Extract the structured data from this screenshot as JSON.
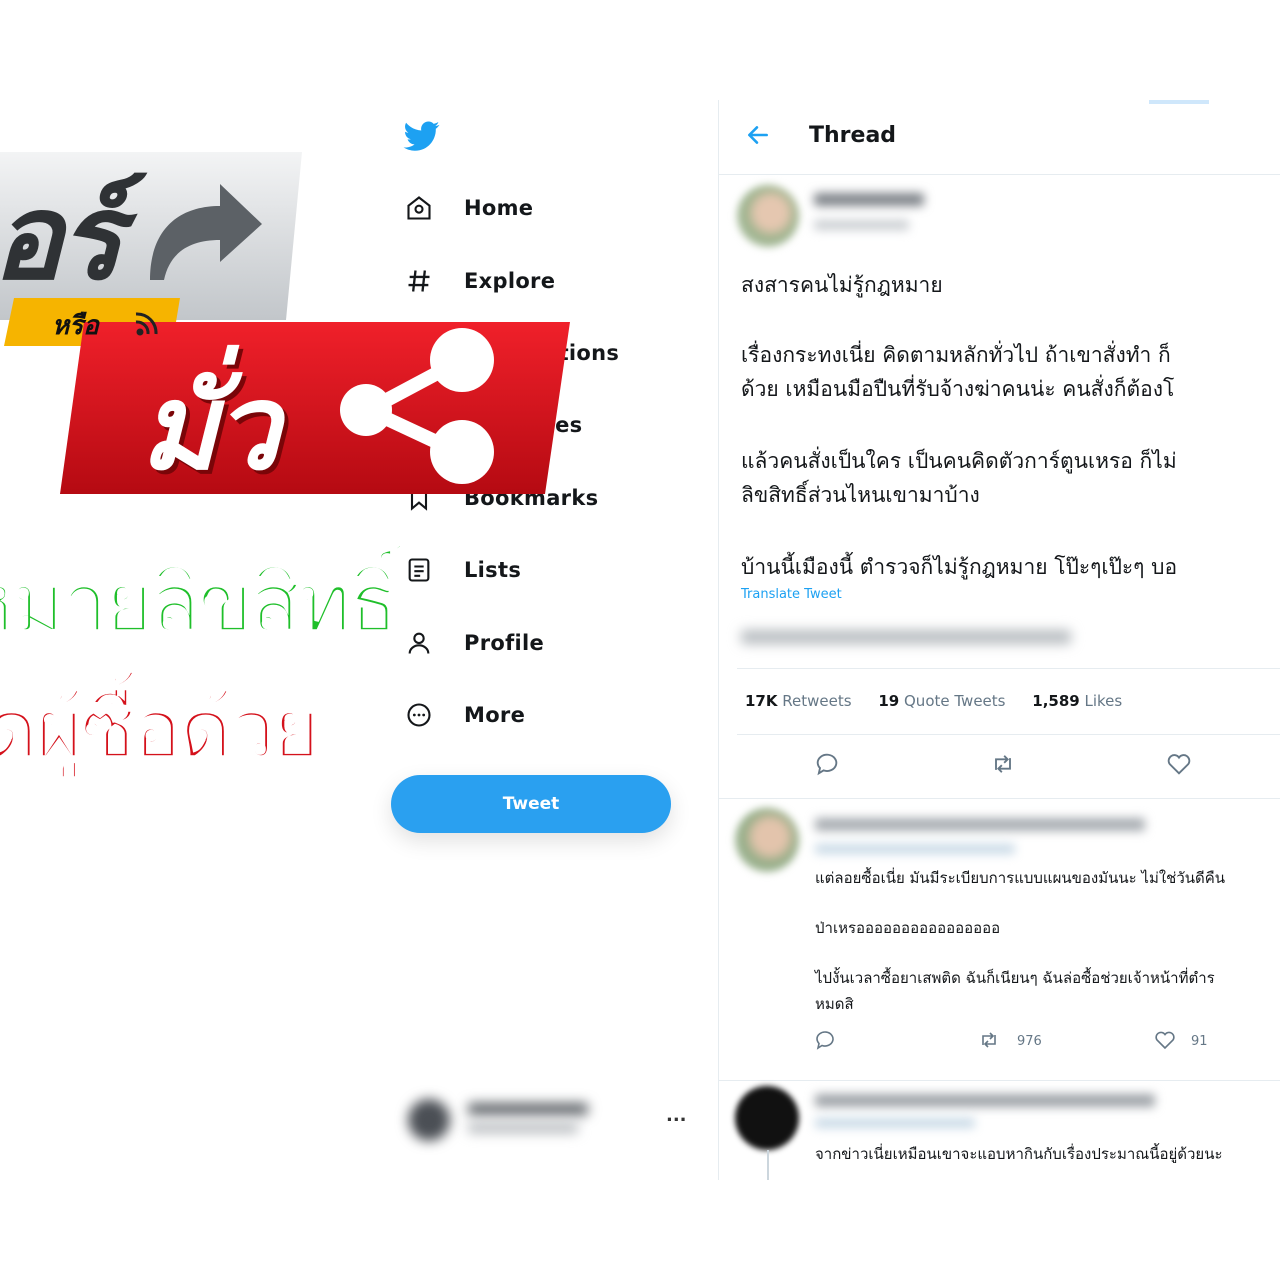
{
  "nav": {
    "items": [
      {
        "id": "home",
        "label": "Home",
        "icon": "home-icon"
      },
      {
        "id": "explore",
        "label": "Explore",
        "icon": "hashtag-icon"
      },
      {
        "id": "notifications",
        "label": "Notifications",
        "icon": "bell-icon"
      },
      {
        "id": "messages",
        "label": "Messages",
        "icon": "mail-icon"
      },
      {
        "id": "bookmarks",
        "label": "Bookmarks",
        "icon": "bookmark-icon"
      },
      {
        "id": "lists",
        "label": "Lists",
        "icon": "list-icon"
      },
      {
        "id": "profile",
        "label": "Profile",
        "icon": "person-icon"
      },
      {
        "id": "more",
        "label": "More",
        "icon": "more-circle-icon"
      }
    ],
    "tweet_button": "Tweet",
    "account_more": "..."
  },
  "thread": {
    "title": "Thread",
    "tweet": {
      "paragraphs": [
        "สงสารคนไม่รู้กฎหมาย",
        "เรื่องกระทงเนี่ย คิดตามหลักทั่วไป ถ้าเขาสั่งทำ ก็",
        "ด้วย เหมือนมือปืนที่รับจ้างฆ่าคนน่ะ คนสั่งก็ต้องโ",
        "แล้วคนสั่งเป็นใคร เป็นคนคิดตัวการ์ตูนเหรอ ก็ไม่",
        "ลิขสิทธิ์ส่วนไหนเขามาบ้าง",
        "บ้านนี้เมืองนี้ ตำรวจก็ไม่รู้กฎหมาย โป๊ะๆเป๊ะๆ บอ"
      ],
      "translate": "Translate Tweet",
      "stats": {
        "retweets_count": "17K",
        "retweets_label": "Retweets",
        "quotes_count": "19",
        "quotes_label": "Quote Tweets",
        "likes_count": "1,589",
        "likes_label": "Likes"
      }
    },
    "reply1": {
      "lines": [
        "แต่ลอยซื้อเนี่ย มันมีระเบียบการแบบแผนของมันนะ ไม่ใช่วันดีคืน",
        "ป่าเหรออออออออออออออออ",
        "ไปงั้นเวลาซื้อยาเสพติด ฉันก็เนียนๆ ฉันล่อซื้อช่วยเจ้าหน้าที่ตำร",
        "หมดสิ"
      ],
      "retweets": "976",
      "likes": "91"
    },
    "reply2": {
      "lines": [
        "จากข่าวเนี่ยเหมือนเขาจะแอบหากินกับเรื่องประมาณนี้อยู่ด้วยนะ"
      ]
    }
  },
  "overlay": {
    "brand_fragment": "อร์",
    "or_label": "หรือ",
    "mua_label": "มั่ว",
    "headline1": "หมายลิขสิทธิ์",
    "headline2": "ผิดผู้ซื้อด้วย",
    "colors": {
      "red": "#d4111b",
      "green": "#1fbf2a",
      "yellow": "#f7b500",
      "gray_banner": "#cfd2d6"
    }
  }
}
